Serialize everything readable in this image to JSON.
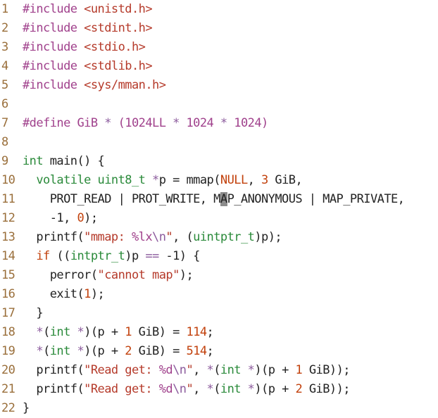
{
  "editor": {
    "lines": [
      {
        "n": "1",
        "tokens": [
          {
            "t": "#include ",
            "c": "kw"
          },
          {
            "t": "<unistd.h>",
            "c": "str"
          }
        ]
      },
      {
        "n": "2",
        "tokens": [
          {
            "t": "#include ",
            "c": "kw"
          },
          {
            "t": "<stdint.h>",
            "c": "str"
          }
        ]
      },
      {
        "n": "3",
        "tokens": [
          {
            "t": "#include ",
            "c": "kw"
          },
          {
            "t": "<stdio.h>",
            "c": "str"
          }
        ]
      },
      {
        "n": "4",
        "tokens": [
          {
            "t": "#include ",
            "c": "kw"
          },
          {
            "t": "<stdlib.h>",
            "c": "str"
          }
        ]
      },
      {
        "n": "5",
        "tokens": [
          {
            "t": "#include ",
            "c": "kw"
          },
          {
            "t": "<sys/mman.h>",
            "c": "str"
          }
        ]
      },
      {
        "n": "6",
        "tokens": []
      },
      {
        "n": "7",
        "tokens": [
          {
            "t": "#define ",
            "c": "kw"
          },
          {
            "t": "GiB ",
            "c": "kw"
          },
          {
            "t": "* ",
            "c": "op"
          },
          {
            "t": "(",
            "c": "kw"
          },
          {
            "t": "1024LL ",
            "c": "kw"
          },
          {
            "t": "* ",
            "c": "op"
          },
          {
            "t": "1024 ",
            "c": "kw"
          },
          {
            "t": "* ",
            "c": "op"
          },
          {
            "t": "1024)",
            "c": "kw"
          }
        ]
      },
      {
        "n": "8",
        "tokens": []
      },
      {
        "n": "9",
        "tokens": [
          {
            "t": "int",
            "c": "ty"
          },
          {
            "t": " main() {",
            "c": ""
          }
        ]
      },
      {
        "n": "10",
        "tokens": [
          {
            "t": "  ",
            "c": ""
          },
          {
            "t": "volatile ",
            "c": "ty"
          },
          {
            "t": "uint8_t ",
            "c": "ty"
          },
          {
            "t": "*",
            "c": "op"
          },
          {
            "t": "p = mmap(",
            "c": ""
          },
          {
            "t": "NULL",
            "c": "num"
          },
          {
            "t": ", ",
            "c": ""
          },
          {
            "t": "3",
            "c": "num"
          },
          {
            "t": " GiB,",
            "c": ""
          }
        ]
      },
      {
        "n": "11",
        "tokens": [
          {
            "t": "    PROT_READ | PROT_WRITE, M",
            "c": ""
          },
          {
            "t": "A",
            "c": "cur"
          },
          {
            "t": "P_ANONYMOUS | MAP_PRIVATE,",
            "c": ""
          }
        ]
      },
      {
        "n": "12",
        "tokens": [
          {
            "t": "    -1, ",
            "c": ""
          },
          {
            "t": "0",
            "c": "num"
          },
          {
            "t": ");",
            "c": ""
          }
        ]
      },
      {
        "n": "13",
        "tokens": [
          {
            "t": "  printf(",
            "c": ""
          },
          {
            "t": "\"mmap: ",
            "c": "str"
          },
          {
            "t": "%lx",
            "c": "kw"
          },
          {
            "t": "\\n",
            "c": "op"
          },
          {
            "t": "\"",
            "c": "str"
          },
          {
            "t": ", (",
            "c": ""
          },
          {
            "t": "uintptr_t",
            "c": "ty"
          },
          {
            "t": ")p);",
            "c": ""
          }
        ]
      },
      {
        "n": "14",
        "tokens": [
          {
            "t": "  ",
            "c": ""
          },
          {
            "t": "if",
            "c": "num"
          },
          {
            "t": " ((",
            "c": ""
          },
          {
            "t": "intptr_t",
            "c": "ty"
          },
          {
            "t": ")p ",
            "c": ""
          },
          {
            "t": "==",
            "c": "op"
          },
          {
            "t": " -1) {",
            "c": ""
          }
        ]
      },
      {
        "n": "15",
        "tokens": [
          {
            "t": "    perror(",
            "c": ""
          },
          {
            "t": "\"cannot map\"",
            "c": "str"
          },
          {
            "t": ");",
            "c": ""
          }
        ]
      },
      {
        "n": "16",
        "tokens": [
          {
            "t": "    exit(",
            "c": ""
          },
          {
            "t": "1",
            "c": "num"
          },
          {
            "t": ");",
            "c": ""
          }
        ]
      },
      {
        "n": "17",
        "tokens": [
          {
            "t": "  }",
            "c": ""
          }
        ]
      },
      {
        "n": "18",
        "tokens": [
          {
            "t": "  ",
            "c": ""
          },
          {
            "t": "*",
            "c": "op"
          },
          {
            "t": "(",
            "c": ""
          },
          {
            "t": "int ",
            "c": "ty"
          },
          {
            "t": "*",
            "c": "op"
          },
          {
            "t": ")(p + ",
            "c": ""
          },
          {
            "t": "1",
            "c": "num"
          },
          {
            "t": " GiB) = ",
            "c": ""
          },
          {
            "t": "114",
            "c": "num"
          },
          {
            "t": ";",
            "c": ""
          }
        ]
      },
      {
        "n": "19",
        "tokens": [
          {
            "t": "  ",
            "c": ""
          },
          {
            "t": "*",
            "c": "op"
          },
          {
            "t": "(",
            "c": ""
          },
          {
            "t": "int ",
            "c": "ty"
          },
          {
            "t": "*",
            "c": "op"
          },
          {
            "t": ")(p + ",
            "c": ""
          },
          {
            "t": "2",
            "c": "num"
          },
          {
            "t": " GiB) = ",
            "c": ""
          },
          {
            "t": "514",
            "c": "num"
          },
          {
            "t": ";",
            "c": ""
          }
        ]
      },
      {
        "n": "20",
        "tokens": [
          {
            "t": "  printf(",
            "c": ""
          },
          {
            "t": "\"Read get: ",
            "c": "str"
          },
          {
            "t": "%d",
            "c": "kw"
          },
          {
            "t": "\\n",
            "c": "op"
          },
          {
            "t": "\"",
            "c": "str"
          },
          {
            "t": ", ",
            "c": ""
          },
          {
            "t": "*",
            "c": "op"
          },
          {
            "t": "(",
            "c": ""
          },
          {
            "t": "int ",
            "c": "ty"
          },
          {
            "t": "*",
            "c": "op"
          },
          {
            "t": ")(p + ",
            "c": ""
          },
          {
            "t": "1",
            "c": "num"
          },
          {
            "t": " GiB));",
            "c": ""
          }
        ]
      },
      {
        "n": "21",
        "tokens": [
          {
            "t": "  printf(",
            "c": ""
          },
          {
            "t": "\"Read get: ",
            "c": "str"
          },
          {
            "t": "%d",
            "c": "kw"
          },
          {
            "t": "\\n",
            "c": "op"
          },
          {
            "t": "\"",
            "c": "str"
          },
          {
            "t": ", ",
            "c": ""
          },
          {
            "t": "*",
            "c": "op"
          },
          {
            "t": "(",
            "c": ""
          },
          {
            "t": "int ",
            "c": "ty"
          },
          {
            "t": "*",
            "c": "op"
          },
          {
            "t": ")(p + ",
            "c": ""
          },
          {
            "t": "2",
            "c": "num"
          },
          {
            "t": " GiB));",
            "c": ""
          }
        ]
      },
      {
        "n": "22",
        "tokens": [
          {
            "t": "}",
            "c": ""
          }
        ]
      }
    ]
  },
  "colors": {
    "line_number": "#9a6f3b",
    "keyword": "#a0418c",
    "type": "#2a8a3a",
    "number": "#c2410c",
    "string": "#b53a2a",
    "operator": "#8b5a9c",
    "text": "#222222",
    "cursor": "#8c8c8c"
  }
}
